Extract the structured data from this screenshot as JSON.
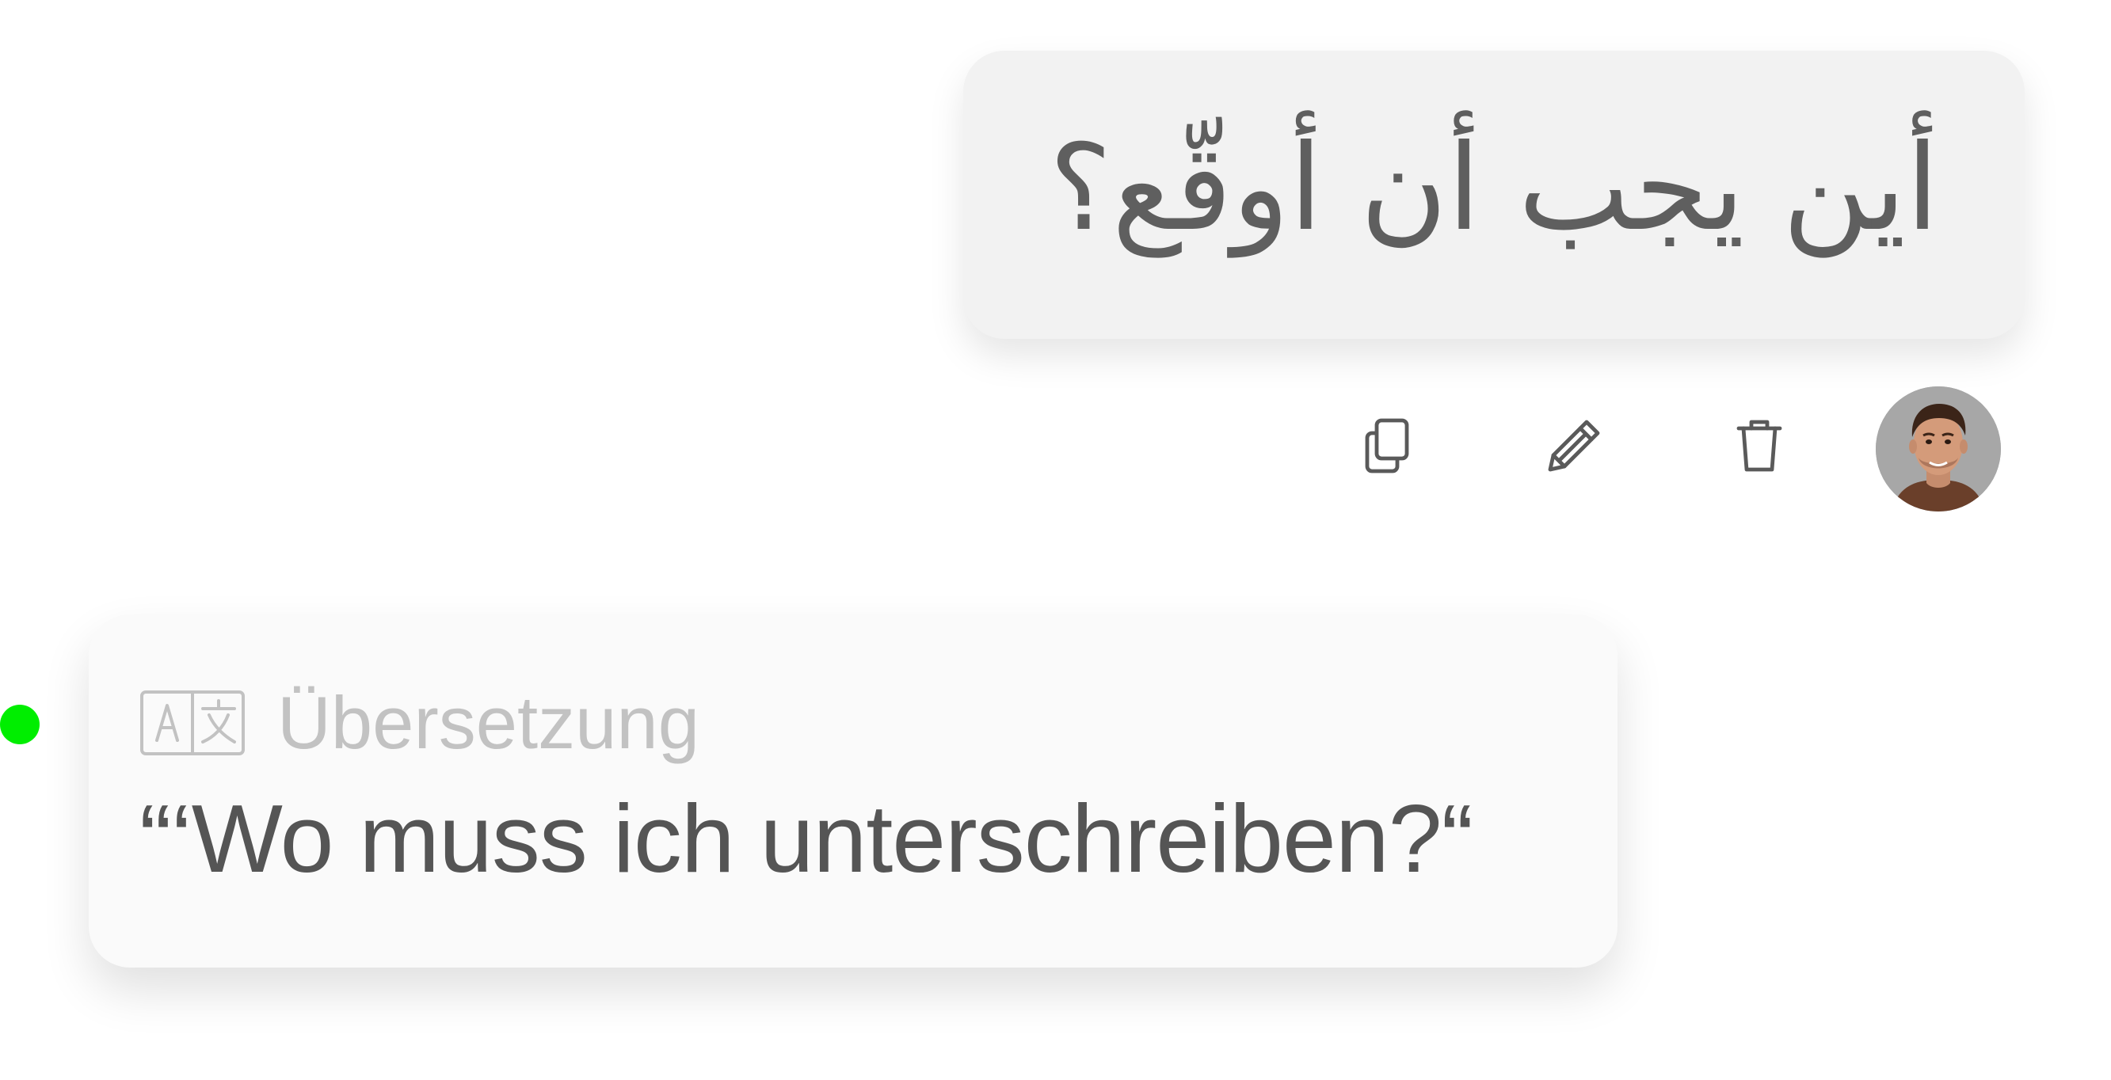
{
  "message": {
    "text": "أين يجب أن أوقّع؟",
    "direction": "rtl"
  },
  "actions": {
    "copy": {
      "icon": "copy-icon"
    },
    "edit": {
      "icon": "pencil-icon"
    },
    "delete": {
      "icon": "trash-icon"
    }
  },
  "user": {
    "avatar_icon": "user-avatar"
  },
  "status": {
    "color": "#00ee00"
  },
  "translation": {
    "icon": "translate-icon",
    "label": "Übersetzung",
    "text": "“‘Wo muss ich unterschreiben?“"
  },
  "colors": {
    "bubble_bg": "#f2f2f2",
    "card_bg": "#fafafa",
    "text_primary": "#555555",
    "label_muted": "#c2c2c2",
    "status_online": "#00ee00"
  }
}
